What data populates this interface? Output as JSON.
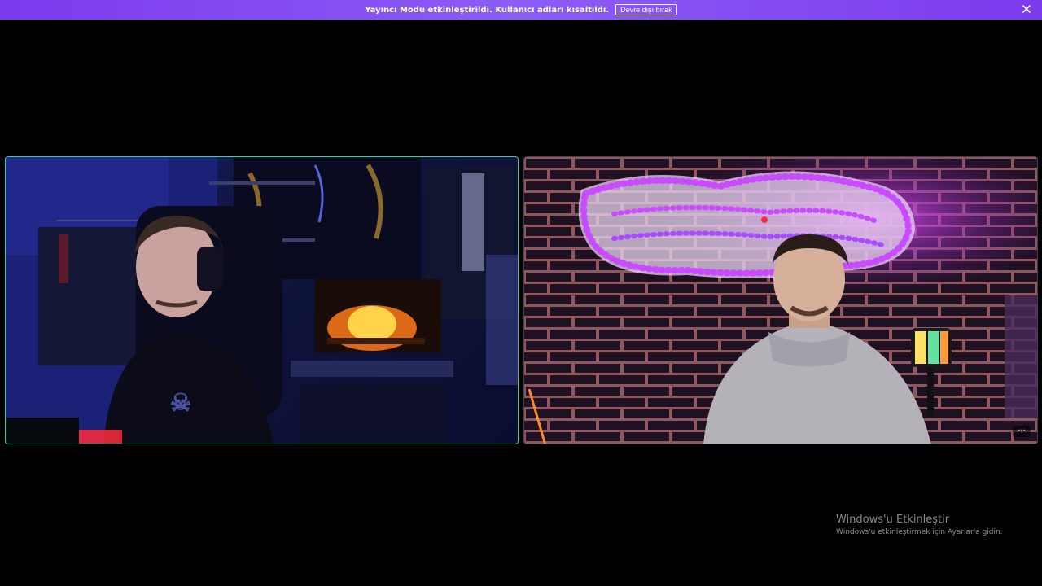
{
  "banner": {
    "message": "Yayıncı Modu etkinleştirildi. Kullanıcı adları kısaltıldı.",
    "disable_button": "Devre dışı bırak",
    "close_icon": "close-icon",
    "background": "#7c3aed"
  },
  "tiles": [
    {
      "id": "participant-1",
      "speaking": true,
      "border_color": "#34d399"
    },
    {
      "id": "participant-2",
      "speaking": false,
      "more_icon": "more-options-icon",
      "more_label": "···"
    }
  ],
  "watermark": {
    "title": "Windows'u Etkinleştir",
    "subtitle": "Windows'u etkinleştirmek için Ayarlar'a gidin."
  }
}
